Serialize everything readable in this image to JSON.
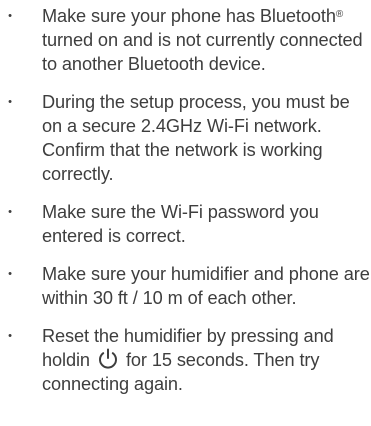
{
  "items": [
    {
      "pre": "Make sure your phone has Bluetooth",
      "reg": "®",
      "post": " turned on and is not currently connected to another Bluetooth device."
    },
    {
      "text": "During the setup process, you must be on a secure 2.4GHz Wi-Fi network. Confirm that the network is working correctly."
    },
    {
      "text": "Make sure the Wi-Fi password you entered is correct."
    },
    {
      "text": "Make sure your humidifier and phone are within 30 ft / 10 m of each other."
    },
    {
      "pre": "Reset the humidifier by pressing and holdin",
      "post": "for 15 seconds. Then try connecting again.",
      "icon": "power-icon"
    }
  ],
  "bullet_symbol": "•",
  "colors": {
    "text": "#3e3e3e"
  }
}
